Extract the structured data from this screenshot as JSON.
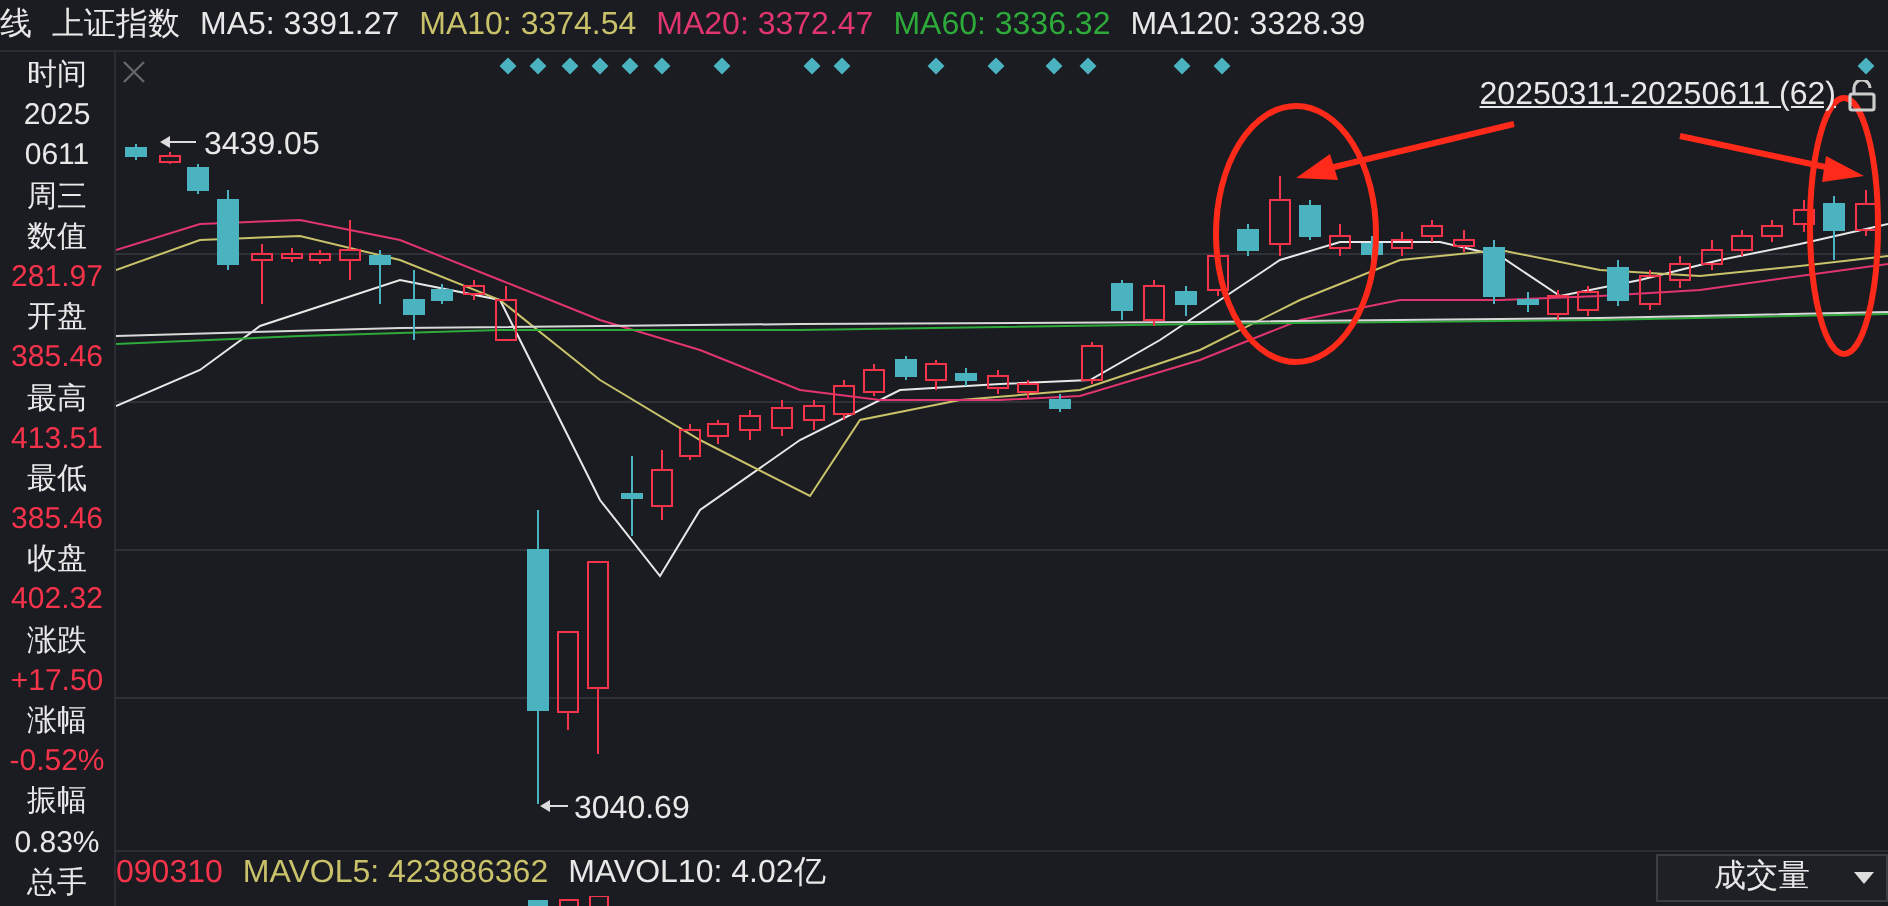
{
  "header": {
    "title_fragment": "线",
    "index_name": "上证指数",
    "moving_averages": [
      {
        "label": "MA5: 3391.27",
        "color": "#e8e8e8"
      },
      {
        "label": "MA10: 3374.54",
        "color": "#c9c26a"
      },
      {
        "label": "MA20: 3372.47",
        "color": "#e0356e"
      },
      {
        "label": "MA60: 3336.32",
        "color": "#2eaa3a"
      },
      {
        "label": "MA120: 3328.39",
        "color": "#e8e8e8"
      }
    ]
  },
  "info_panel": [
    {
      "kind": "label",
      "text": "时间"
    },
    {
      "kind": "value",
      "text": "2025",
      "color": "#e8e8e8"
    },
    {
      "kind": "value",
      "text": "0611",
      "color": "#e8e8e8"
    },
    {
      "kind": "value",
      "text": "周三",
      "color": "#e8e8e8"
    },
    {
      "kind": "label",
      "text": "数值"
    },
    {
      "kind": "value",
      "text": "281.97",
      "color": "#f5334a"
    },
    {
      "kind": "label",
      "text": "开盘"
    },
    {
      "kind": "value",
      "text": "385.46",
      "color": "#f5334a"
    },
    {
      "kind": "label",
      "text": "最高"
    },
    {
      "kind": "value",
      "text": "413.51",
      "color": "#f5334a"
    },
    {
      "kind": "label",
      "text": "最低"
    },
    {
      "kind": "value",
      "text": "385.46",
      "color": "#f5334a"
    },
    {
      "kind": "label",
      "text": "收盘"
    },
    {
      "kind": "value",
      "text": "402.32",
      "color": "#f5334a"
    },
    {
      "kind": "label",
      "text": "涨跌"
    },
    {
      "kind": "value",
      "text": "+17.50",
      "color": "#f5334a"
    },
    {
      "kind": "label",
      "text": "涨幅"
    },
    {
      "kind": "value",
      "text": "-0.52%",
      "color": "#f5334a"
    },
    {
      "kind": "label",
      "text": "振幅"
    },
    {
      "kind": "value",
      "text": "0.83%",
      "color": "#e8e8e8"
    },
    {
      "kind": "label",
      "text": "总手"
    }
  ],
  "chart": {
    "range_label": "20250311-20250611 (62)",
    "high_label": "3439.05",
    "low_label": "3040.69"
  },
  "volume_bar": {
    "labels": [
      {
        "text": "090310",
        "color": "#f5334a"
      },
      {
        "text": "MAVOL5: 423886362",
        "color": "#c9c26a"
      },
      {
        "text": "MAVOL10: 4.02亿",
        "color": "#e8e8e8"
      }
    ],
    "dropdown": "成交量"
  }
}
